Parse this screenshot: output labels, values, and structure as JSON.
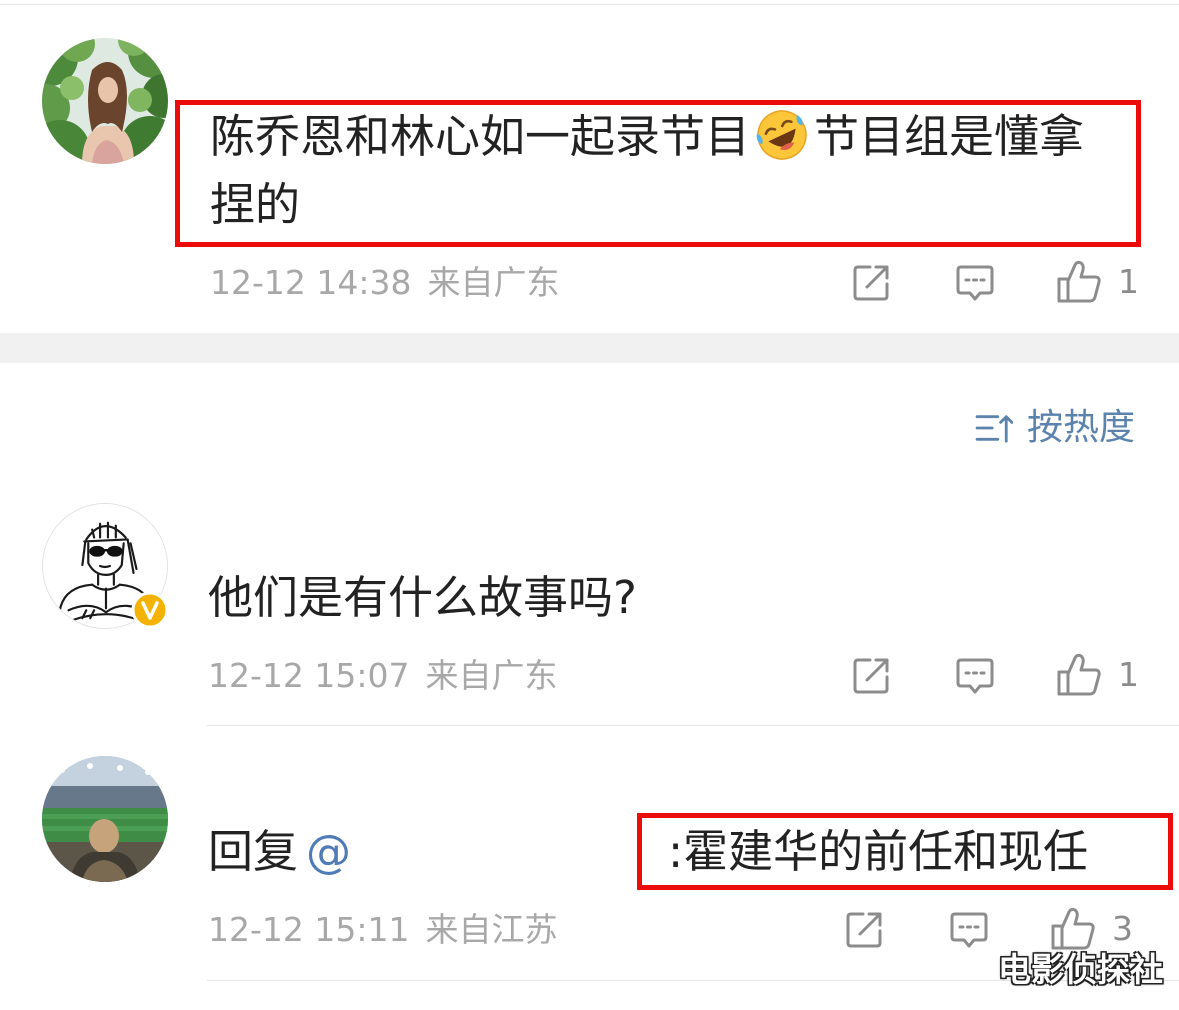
{
  "comments": [
    {
      "text_before_emoji": "陈乔恩和林心如一起录节目",
      "emoji": "laughing-crying-emoji-icon",
      "text_after_emoji": "节目组是懂拿捏的",
      "time": "12-12 14:38",
      "location": "来自广东",
      "like_count": "1"
    },
    {
      "text": "他们是有什么故事吗?",
      "badge_icon": "verified-badge-icon",
      "time": "12-12 15:07",
      "location": "来自广东",
      "like_count": "1"
    },
    {
      "reply_prefix": "回复",
      "mention": "@",
      "text": ":霍建华的前任和现任",
      "time": "12-12 15:11",
      "location": "来自江苏",
      "like_count": "3"
    }
  ],
  "sort": {
    "label": "按热度",
    "icon": "sort-icon"
  },
  "actions": {
    "share_icon": "share-icon",
    "comment_icon": "comment-icon",
    "like_icon": "like-icon"
  },
  "watermark": "电影侦探社",
  "colors": {
    "text": "#222222",
    "meta": "#a8a8a8",
    "icon": "#8c8c8c",
    "link": "#5b83ad",
    "mention": "#4f7cb7",
    "highlight": "#ec0b0b",
    "verified": "#f5b301",
    "section_band": "#f1f1f1"
  }
}
